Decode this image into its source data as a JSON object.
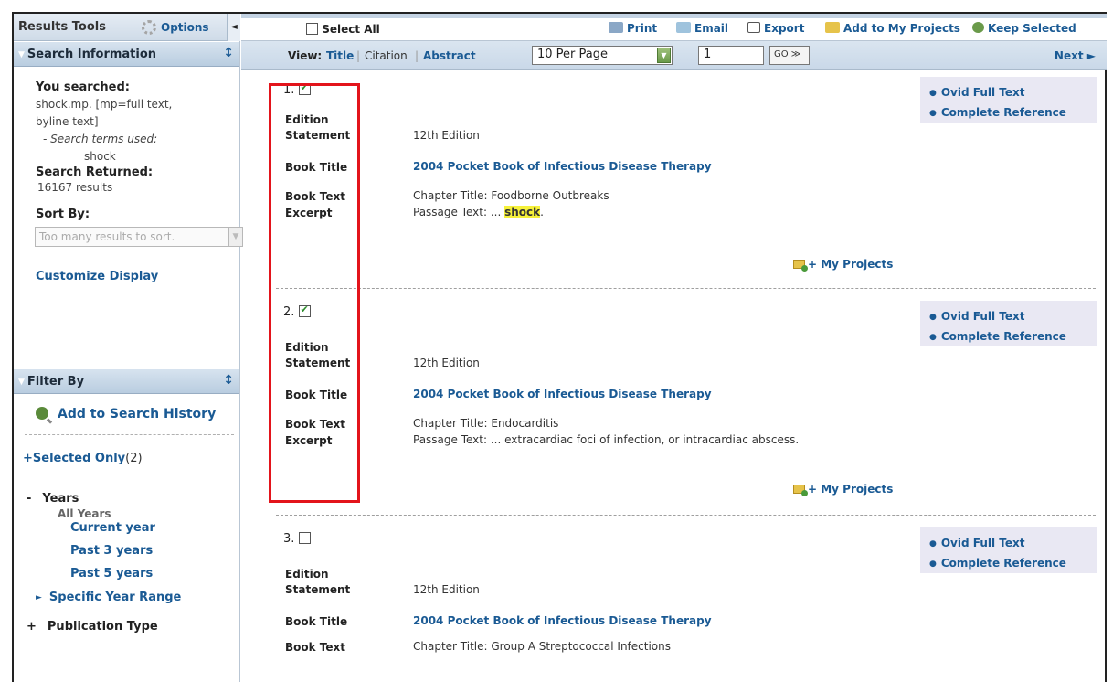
{
  "left_panel": {
    "results_tools": "Results Tools",
    "options": "Options",
    "search_info_title": "Search Information",
    "you_searched_label": "You searched:",
    "search_query_line1": "shock.mp. [mp=full text,",
    "search_query_line2": "byline text]",
    "terms_used_label": "- Search terms used:",
    "term": "shock",
    "returned_label": "Search Returned:",
    "returned_value": "16167 results",
    "sort_label": "Sort By:",
    "sort_placeholder": "Too many results to sort.",
    "customize": "Customize Display",
    "filter_title": "Filter By",
    "add_history": "Add to Search History",
    "selected_only": "+Selected Only",
    "selected_count": "(2)",
    "years_toggle": "-",
    "years_label": "Years",
    "all_years": "All Years",
    "current_year": "Current year",
    "past3": "Past 3 years",
    "past5": "Past 5 years",
    "specific_range": "Specific Year Range",
    "pub_type_toggle": "+",
    "pub_type": "Publication Type"
  },
  "toolbar": {
    "select_all": "Select All",
    "print": "Print",
    "email": "Email",
    "export": "Export",
    "add_projects": "Add to My Projects",
    "keep_selected": "Keep Selected"
  },
  "viewbar": {
    "view_label": "View:",
    "title": "Title",
    "citation": "Citation",
    "abstract": "Abstract",
    "per_page": "10 Per Page",
    "page": "1",
    "go": "GO ≫",
    "next": "Next ►"
  },
  "labels": {
    "edition": "Edition",
    "statement": "Statement",
    "book_title": "Book Title",
    "book_text": "Book Text",
    "excerpt": "Excerpt",
    "ovid_full_text": "Ovid Full Text",
    "complete_reference": "Complete Reference",
    "my_projects": "+ My Projects"
  },
  "results": [
    {
      "num": "1.",
      "checked": true,
      "edition": "12th Edition",
      "book_title": "2004 Pocket Book of Infectious Disease Therapy",
      "chapter": "Chapter Title: Foodborne Outbreaks",
      "passage_prefix": "Passage Text: ... ",
      "passage_highlight": "shock",
      "passage_suffix": "."
    },
    {
      "num": "2.",
      "checked": true,
      "edition": "12th Edition",
      "book_title": "2004 Pocket Book of Infectious Disease Therapy",
      "chapter": "Chapter Title: Endocarditis",
      "passage_prefix": "Passage Text: ... extracardiac foci of infection, or intracardiac abscess.",
      "passage_highlight": "",
      "passage_suffix": ""
    },
    {
      "num": "3.",
      "checked": false,
      "edition": "12th Edition",
      "book_title": "2004 Pocket Book of Infectious Disease Therapy",
      "chapter": "Chapter Title: Group A Streptococcal Infections",
      "passage_prefix": "",
      "passage_highlight": "",
      "passage_suffix": ""
    }
  ],
  "colors": {
    "link": "#1a5a94",
    "highlight": "#f6f13a",
    "annotation_box": "#e3141b"
  }
}
